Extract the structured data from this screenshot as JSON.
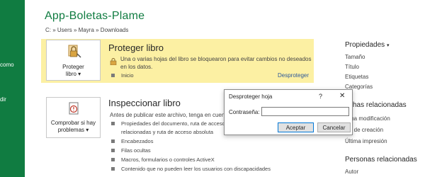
{
  "sidebar": {
    "items": [
      {
        "label": "como"
      },
      {
        "label": "dir"
      }
    ]
  },
  "file": {
    "title": "App-Boletas-Plame",
    "path": "C: » Users » Mayra » Downloads"
  },
  "protect": {
    "button_line1": "Proteger",
    "button_line2": "libro",
    "title": "Proteger libro",
    "description": "Una o varias hojas del libro se bloquearon para evitar cambios no deseados en los datos.",
    "sub_item": "Inicio",
    "link": "Desproteger"
  },
  "inspect": {
    "button_line1": "Comprobar si hay",
    "button_line2": "problemas",
    "title": "Inspeccionar libro",
    "description": "Antes de publicar este archivo, tenga en cuent",
    "bullets": [
      "Propiedades del documento, ruta de acceso",
      "relacionadas y ruta de acceso absoluta",
      "Encabezados",
      "Filas ocultas",
      "Macros, formularios o controles ActiveX",
      "Contenido que no pueden leer los usuarios con discapacidades"
    ]
  },
  "right_panel": {
    "properties_title": "Propiedades",
    "properties": [
      "Tamaño",
      "Título",
      "Etiquetas",
      "Categorías"
    ],
    "dates_title": "chas relacionadas",
    "dates": [
      "ma modificación",
      "a de creación",
      "Última impresión"
    ],
    "people_title": "Personas relacionadas",
    "people": [
      "Autor"
    ]
  },
  "dialog": {
    "title": "Desproteger hoja",
    "help": "?",
    "close": "✕",
    "password_label": "Contraseña:",
    "password_value": "",
    "ok_label": "Aceptar",
    "cancel_label": "Cancelar"
  },
  "colors": {
    "brand_green": "#107c41",
    "highlight_yellow": "#fcf0a3",
    "link_blue": "#2b579a"
  }
}
